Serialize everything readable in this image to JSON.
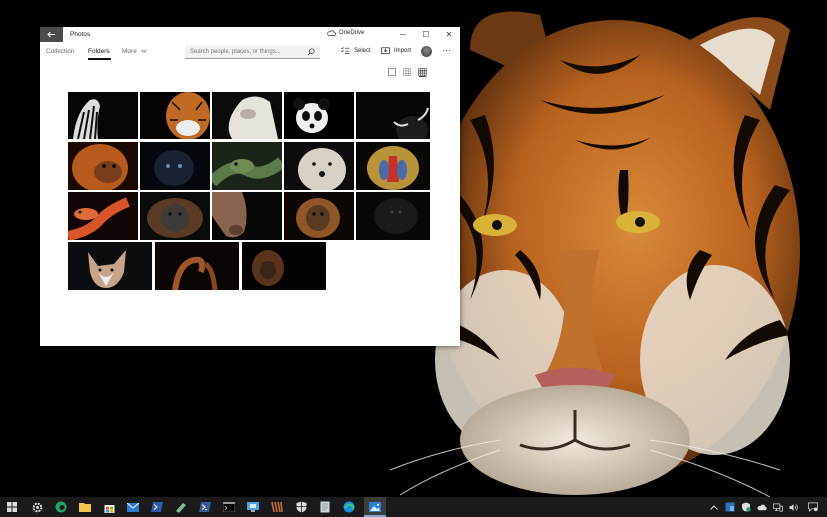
{
  "window": {
    "title": "Photos",
    "back_icon": "arrow-left-icon",
    "onedrive_label": "OneDrive",
    "minimize": "─",
    "maximize": "☐",
    "close": "✕"
  },
  "nav": {
    "tabs": [
      {
        "label": "Collection",
        "active": false
      },
      {
        "label": "Folders",
        "active": true
      },
      {
        "label": "More",
        "active": false
      }
    ]
  },
  "search": {
    "placeholder": "Search people, places, or things..."
  },
  "toolbar": {
    "select_label": "Select",
    "import_label": "Import",
    "more_label": "···"
  },
  "view_options": [
    "single-view-icon",
    "medium-grid-icon",
    "dense-grid-icon"
  ],
  "photos": [
    {
      "subject": "zebra"
    },
    {
      "subject": "tiger"
    },
    {
      "subject": "white horse"
    },
    {
      "subject": "panda"
    },
    {
      "subject": "bull"
    },
    {
      "subject": "orangutan"
    },
    {
      "subject": "black panther"
    },
    {
      "subject": "green snake"
    },
    {
      "subject": "polar bear"
    },
    {
      "subject": "mandrill"
    },
    {
      "subject": "corn snake"
    },
    {
      "subject": "orangutan"
    },
    {
      "subject": "horse"
    },
    {
      "subject": "orangutan"
    },
    {
      "subject": "gorilla"
    },
    {
      "subject": "fox"
    },
    {
      "subject": "monkey hands"
    },
    {
      "subject": "orangutan"
    }
  ],
  "taskbar": {
    "icons": [
      "start-icon",
      "settings-icon",
      "edge-dev-icon",
      "file-explorer-icon",
      "store-icon",
      "mail-icon",
      "powershell-icon",
      "whiteboard-icon",
      "terminal-icon",
      "cmd-icon",
      "remote-desktop-icon",
      "winrar-icon",
      "defender-icon",
      "notepad-icon",
      "edge-icon",
      "photos-icon"
    ],
    "tray": [
      "chevron-up-icon",
      "tray-app-icon",
      "security-icon",
      "onedrive-icon",
      "network-icon",
      "volume-icon",
      "notification-icon"
    ]
  }
}
